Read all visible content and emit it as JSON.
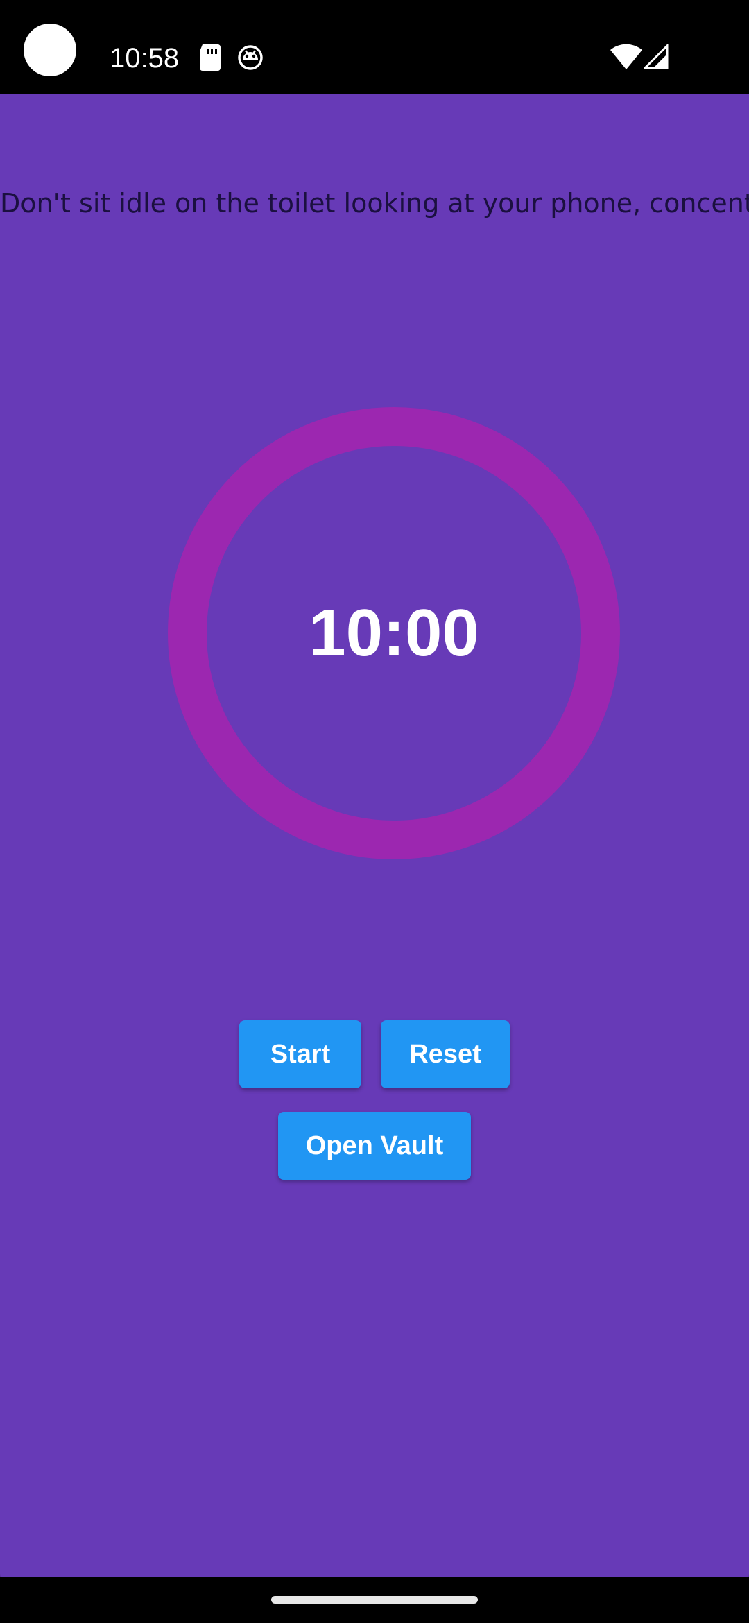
{
  "status_bar": {
    "time": "10:58",
    "icons": [
      "sd-card-icon",
      "bug-icon",
      "wifi-icon",
      "signal-icon"
    ]
  },
  "main": {
    "tagline": "Don't sit idle on the toilet looking at your phone, concentrate!",
    "timer": {
      "value": "10:00",
      "ring_color": "#9C27B0"
    },
    "buttons": {
      "start": "Start",
      "reset": "Reset",
      "open_vault": "Open Vault"
    }
  },
  "colors": {
    "background": "#673AB7",
    "button": "#2196F3",
    "ring": "#9C27B0",
    "text_on_button": "#FFFFFF"
  }
}
